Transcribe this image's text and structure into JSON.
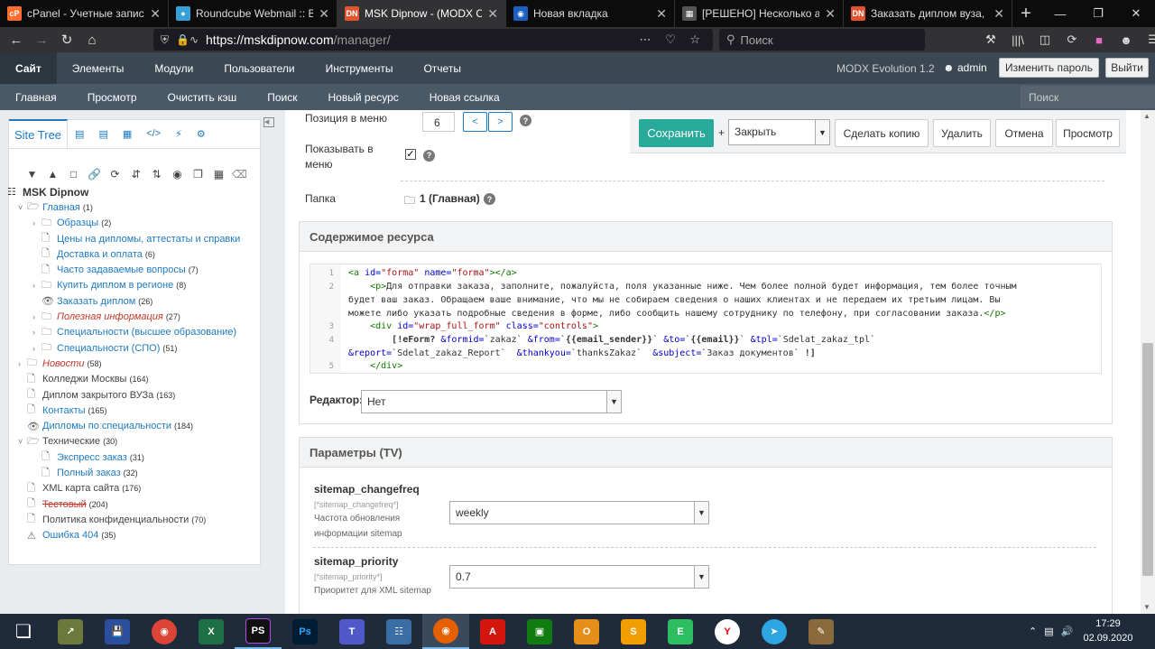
{
  "browser": {
    "tabs": [
      {
        "title": "cPanel - Учетные записи",
        "fav": "cP",
        "color": "#ff6c2c",
        "active": false
      },
      {
        "title": "Roundcube Webmail :: Входя",
        "fav": "●",
        "color": "#37a0d8",
        "active": false
      },
      {
        "title": "MSK Dipnow - (MODX CMS",
        "fav": "DN",
        "color": "#e2542d",
        "active": true
      },
      {
        "title": "Новая вкладка",
        "fav": "◉",
        "color": "#1b5fc1",
        "active": false
      },
      {
        "title": "[РЕШЕНО] Несколько аякс",
        "fav": "▦",
        "color": "#555555",
        "active": false
      },
      {
        "title": "Заказать диплом вуза, ко",
        "fav": "DN",
        "color": "#e2542d",
        "active": false
      }
    ],
    "url_host": "https://mskdipnow.com",
    "url_path": "/manager/",
    "search_placeholder": "Поиск"
  },
  "modx": {
    "menu": [
      "Сайт",
      "Элементы",
      "Модули",
      "Пользователи",
      "Инструменты",
      "Отчеты"
    ],
    "version": "MODX Evolution 1.2",
    "user": "admin",
    "change_password": "Изменить пароль",
    "logout": "Выйти",
    "submenu": [
      "Главная",
      "Просмотр",
      "Очистить кэш",
      "Поиск",
      "Новый ресурс",
      "Новая ссылка"
    ],
    "sub_search": "Поиск"
  },
  "tree": {
    "tab_label": "Site Tree",
    "root": "MSK Dipnow",
    "nodes": [
      {
        "label": "Главная",
        "count": "(1)",
        "lvl": 1,
        "arr": "˅",
        "icon": "folder-open",
        "style": ""
      },
      {
        "label": "Образцы",
        "count": "(2)",
        "lvl": 2,
        "arr": "›",
        "icon": "folder",
        "style": ""
      },
      {
        "label": "Цены на дипломы, аттестаты и справки",
        "count": "",
        "lvl": 2,
        "arr": "",
        "icon": "page",
        "style": ""
      },
      {
        "label": "Доставка и оплата",
        "count": "(6)",
        "lvl": 2,
        "arr": "",
        "icon": "page",
        "style": ""
      },
      {
        "label": "Часто задаваемые вопросы",
        "count": "(7)",
        "lvl": 2,
        "arr": "",
        "icon": "page",
        "style": ""
      },
      {
        "label": "Купить диплом в регионе",
        "count": "(8)",
        "lvl": 2,
        "arr": "›",
        "icon": "folder",
        "style": ""
      },
      {
        "label": "Заказать диплом",
        "count": "(26)",
        "lvl": 2,
        "arr": "",
        "icon": "eye",
        "style": ""
      },
      {
        "label": "Полезная информация",
        "count": "(27)",
        "lvl": 2,
        "arr": "›",
        "icon": "folder",
        "style": "it"
      },
      {
        "label": "Специальности (высшее образование)",
        "count": "",
        "lvl": 2,
        "arr": "›",
        "icon": "folder",
        "style": ""
      },
      {
        "label": "Специальности (СПО)",
        "count": "(51)",
        "lvl": 2,
        "arr": "›",
        "icon": "folder",
        "style": ""
      },
      {
        "label": "Новости",
        "count": "(58)",
        "lvl": 1,
        "arr": "›",
        "icon": "folder",
        "style": "it"
      },
      {
        "label": "Колледжи Москвы",
        "count": "(164)",
        "lvl": 1,
        "arr": "",
        "icon": "page",
        "style": "plain"
      },
      {
        "label": "Диплом закрытого ВУЗа",
        "count": "(163)",
        "lvl": 1,
        "arr": "",
        "icon": "page",
        "style": "plain"
      },
      {
        "label": "Контакты",
        "count": "(165)",
        "lvl": 1,
        "arr": "",
        "icon": "page",
        "style": ""
      },
      {
        "label": "Дипломы по специальности",
        "count": "(184)",
        "lvl": 1,
        "arr": "",
        "icon": "eye",
        "style": ""
      },
      {
        "label": "Технические",
        "count": "(30)",
        "lvl": 1,
        "arr": "˅",
        "icon": "folder-open",
        "style": "plain"
      },
      {
        "label": "Экспресс заказ",
        "count": "(31)",
        "lvl": 2,
        "arr": "",
        "icon": "page",
        "style": ""
      },
      {
        "label": "Полный заказ",
        "count": "(32)",
        "lvl": 2,
        "arr": "",
        "icon": "page",
        "style": ""
      },
      {
        "label": "XML карта сайта",
        "count": "(176)",
        "lvl": 1,
        "arr": "",
        "icon": "page",
        "style": "plain"
      },
      {
        "label": "Тестовый",
        "count": "(204)",
        "lvl": 1,
        "arr": "",
        "icon": "page",
        "style": "strike"
      },
      {
        "label": "Политика конфиденциальности",
        "count": "(70)",
        "lvl": 1,
        "arr": "",
        "icon": "page",
        "style": "plain"
      },
      {
        "label": "Ошибка 404",
        "count": "(35)",
        "lvl": 1,
        "arr": "",
        "icon": "warn",
        "style": ""
      }
    ]
  },
  "form": {
    "menu_position_label": "Позиция в меню",
    "menu_position_value": "6",
    "prev": "<",
    "next": ">",
    "show_in_menu_label": "Показывать в меню",
    "folder_label": "Папка",
    "folder_value": "1 (Главная)",
    "save": "Сохранить",
    "plus": "+",
    "close_option": "Закрыть",
    "duplicate": "Сделать копию",
    "delete": "Удалить",
    "cancel": "Отмена",
    "preview": "Просмотр",
    "content_title": "Содержимое ресурса",
    "editor_label": "Редактор:",
    "editor_value": "Нет",
    "tv_title": "Параметры (TV)",
    "tv": [
      {
        "name": "sitemap_changefreq",
        "code": "[*sitemap_changefreq*]",
        "desc1": "Частота обновления",
        "desc2": "информации sitemap",
        "value": "weekly"
      },
      {
        "name": "sitemap_priority",
        "code": "[*sitemap_priority*]",
        "desc1": "Приоритет для XML sitemap",
        "desc2": "",
        "value": "0.7"
      }
    ]
  },
  "code": {
    "line_numbers": [
      "1",
      "2",
      "3",
      "4",
      "5"
    ]
  },
  "taskbar": {
    "time": "17:29",
    "date": "02.09.2020"
  }
}
